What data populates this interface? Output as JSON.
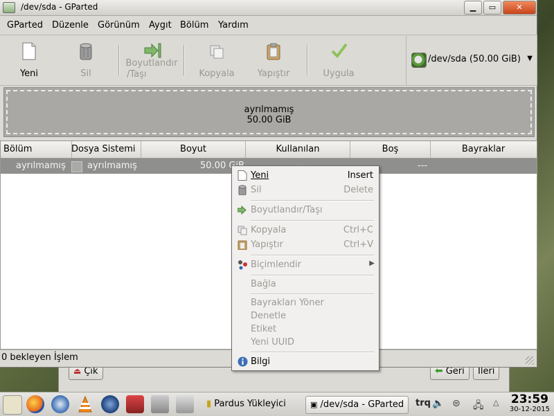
{
  "window": {
    "title": "/dev/sda - GParted",
    "buttons": {
      "minimize": "▁",
      "maximize": "▭",
      "close": "✕"
    }
  },
  "menubar": [
    "GParted",
    "Düzenle",
    "Görünüm",
    "Aygıt",
    "Bölüm",
    "Yardım"
  ],
  "toolbar": {
    "new": "Yeni",
    "delete": "Sil",
    "resize_line1": "Boyutlandır",
    "resize_line2": "/Taşı",
    "copy": "Kopyala",
    "paste": "Yapıştır",
    "apply": "Uygula"
  },
  "device_selector": {
    "value": "/dev/sda   (50.00 GiB)",
    "arrow": "▼"
  },
  "disk_map": {
    "label": "ayrılmamış",
    "size": "50.00 GiB"
  },
  "table": {
    "headers": [
      "Bölüm",
      "Dosya Sistemi",
      "Boyut",
      "Kullanılan",
      "Boş",
      "Bayraklar"
    ],
    "rows": [
      {
        "partition": "ayrılmamış",
        "filesystem": "ayrılmamış",
        "size": "50.00 GiB",
        "used": "---",
        "free": "---",
        "flags": ""
      }
    ]
  },
  "statusbar": "0 bekleyen İşlem",
  "context_menu": {
    "new": {
      "label": "Yeni",
      "shortcut": "Insert"
    },
    "delete": {
      "label": "Sil",
      "shortcut": "Delete"
    },
    "resize": {
      "label": "Boyutlandır/Taşı"
    },
    "copy": {
      "label": "Kopyala",
      "shortcut": "Ctrl+C"
    },
    "paste": {
      "label": "Yapıştır",
      "shortcut": "Ctrl+V"
    },
    "format": {
      "label": "Biçimlendir",
      "arrow": "▶"
    },
    "mount": {
      "label": "Bağla"
    },
    "manage_flags": {
      "label": "Bayrakları Yöner"
    },
    "check": {
      "label": "Denetle"
    },
    "label": {
      "label": "Etiket"
    },
    "new_uuid": {
      "label": "Yeni UUID"
    },
    "info": {
      "label": "Bilgi"
    }
  },
  "background_window": {
    "quit": "Çık",
    "back": "Geri",
    "next": "İleri"
  },
  "taskbar": {
    "installer": "Pardus Yükleyici",
    "gparted": "/dev/sda - GParted",
    "keyboard": "trq",
    "time": "23:59",
    "date": "30-12-2015"
  },
  "colors": {
    "selected_row": "#8f8f8e",
    "unallocated": "#a9a8a5",
    "apply_green": "#7fbf3a",
    "taskbar_bg": "#dcdad6"
  }
}
